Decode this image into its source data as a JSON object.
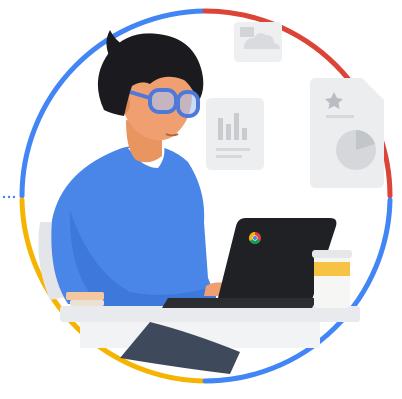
{
  "illustration": {
    "ring_colors": {
      "blue": "#4285F4",
      "red": "#DB4437",
      "yellow": "#F4B400",
      "green": "#0F9D58"
    },
    "person": {
      "hair_color": "#1B1B1F",
      "skin_color": "#F0A070",
      "sweater_color": "#4A86E8",
      "glasses_color": "#4F79D8"
    },
    "laptop": {
      "icon": "chrome-logo-icon",
      "body_color": "#202124"
    },
    "floating_cards": [
      {
        "icon": "cloud-photo-icon"
      },
      {
        "icon": "bar-chart-icon"
      },
      {
        "icon": "star-document-icon"
      },
      {
        "icon": "pie-chart-icon"
      }
    ],
    "coffee_cup_color": "#F6C344",
    "desk_color": "#E8EAED"
  }
}
